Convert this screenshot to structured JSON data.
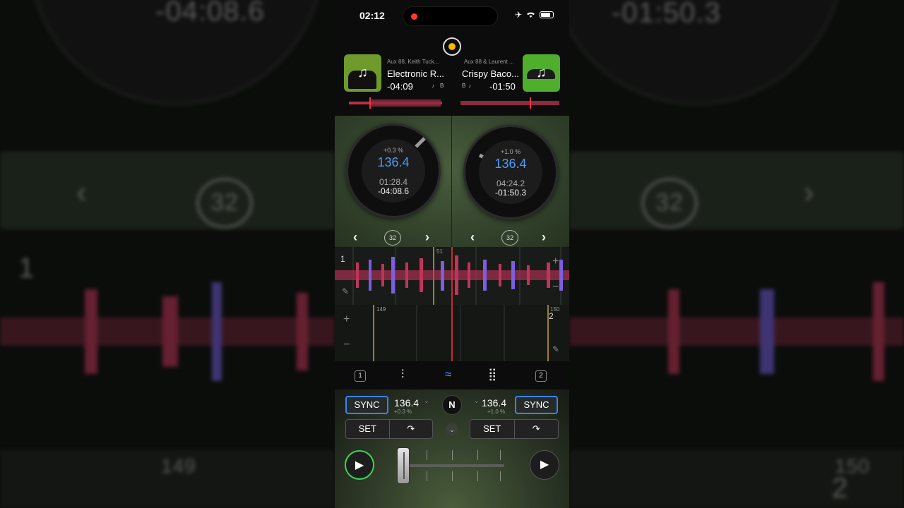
{
  "status_bar": {
    "time": "02:12",
    "icons": [
      "airplane-icon",
      "wifi-icon",
      "battery-icon"
    ]
  },
  "background_zoom": {
    "left_time": "-04:08.6",
    "right_time": "-01:50.3",
    "loop_value": "32",
    "deck_left": "1",
    "deck_right": "2",
    "grid_left": "149",
    "grid_right": "150"
  },
  "deck_a": {
    "artist": "Aux 88, Keith Tuck...",
    "title": "Electronic R...",
    "remaining": "-04:09",
    "key": "B",
    "pitch": "+0.3 %",
    "bpm": "136.4",
    "elapsed": "01:28.4",
    "remaining_full": "-04:08.6",
    "loop_size": "32",
    "sync_label": "SYNC",
    "bpm_sub": "+0.3 %",
    "set_label": "SET",
    "deck_number": "1"
  },
  "deck_b": {
    "artist": "Aux 88 & Laurent ...",
    "title": "Crispy Baco...",
    "remaining": "-01:50",
    "key": "B",
    "pitch": "+1.0 %",
    "bpm": "136.4",
    "elapsed": "04:24.2",
    "remaining_full": "-01:50.3",
    "loop_size": "32",
    "sync_label": "SYNC",
    "bpm_sub": "+1.0 %",
    "set_label": "SET",
    "deck_number": "2"
  },
  "waveform": {
    "top_marker": "51",
    "top_deck": "1",
    "bottom_marker_left": "149",
    "bottom_marker_right": "150",
    "bottom_deck": "2",
    "plus": "+",
    "minus": "−"
  },
  "center_logo": "N",
  "colors": {
    "sync_border": "#3b82f6",
    "bpm": "#4a9dff",
    "play_active": "#3cd45b",
    "master": "#f5b800"
  }
}
